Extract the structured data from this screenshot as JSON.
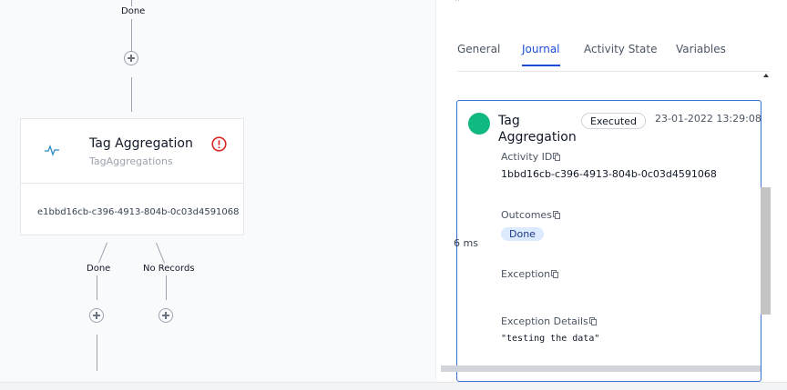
{
  "canvas": {
    "top_edge_label": "Done",
    "node": {
      "title": "Tag Aggregation",
      "subtitle": "TagAggregations",
      "activity_id": "e1bbd16cb-c396-4913-804b-0c03d4591068",
      "icon": "activity-pulse-icon",
      "alert_icon": "exclamation-circle-icon"
    },
    "outcome_edges": [
      "Done",
      "No Records"
    ]
  },
  "panel": {
    "tabs": [
      {
        "label": "General",
        "active": false
      },
      {
        "label": "Journal",
        "active": true
      },
      {
        "label": "Activity State",
        "active": false
      },
      {
        "label": "Variables",
        "active": false
      }
    ],
    "journal_entry": {
      "name": "Tag Aggregation",
      "status_badge": "Executed",
      "status_color": "#10b981",
      "timestamp": "23-01-2022 13:29:08",
      "activity_id_label": "Activity ID",
      "activity_id": "1bbd16cb-c396-4913-804b-0c03d4591068",
      "outcomes_label": "Outcomes",
      "outcome": "Done",
      "exception_label": "Exception",
      "exception_details_label": "Exception Details",
      "exception_details": "\"testing the data\""
    },
    "duration": "6 ms"
  },
  "colors": {
    "accent": "#1d4ed8",
    "card_border": "#3b6fd4",
    "alert": "#dc2626",
    "success": "#10b981"
  }
}
